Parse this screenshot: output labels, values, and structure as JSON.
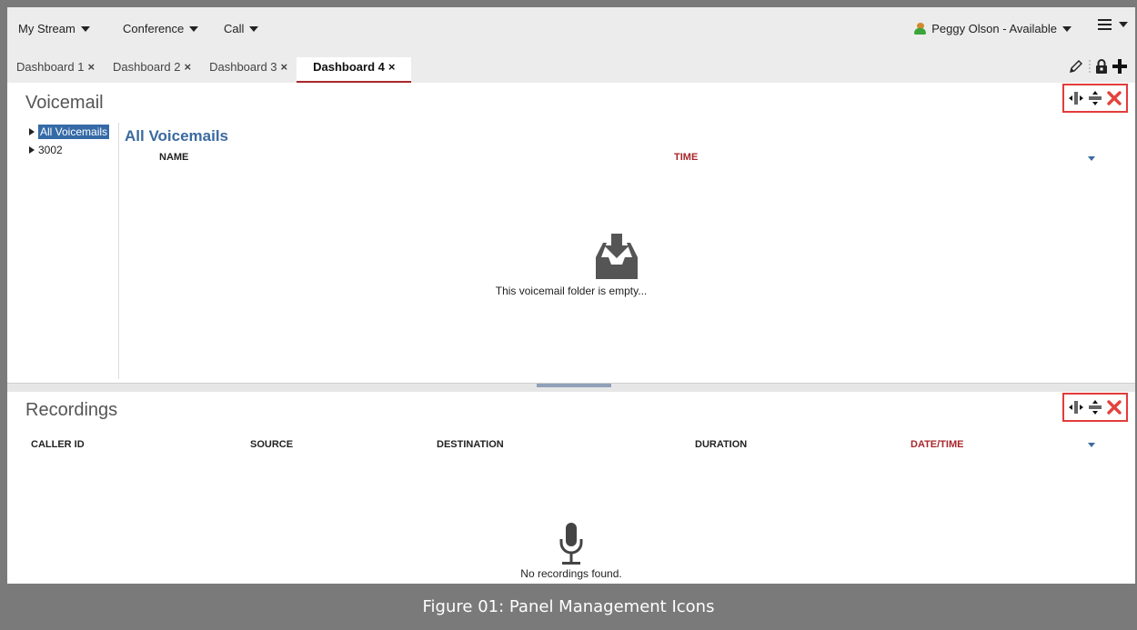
{
  "menubar": {
    "my_stream": "My Stream",
    "conference": "Conference",
    "call": "Call",
    "user_status": "Peggy Olson - Available"
  },
  "tabs": [
    {
      "label": "Dashboard 1",
      "close": "×"
    },
    {
      "label": "Dashboard 2",
      "close": "×"
    },
    {
      "label": "Dashboard 3",
      "close": "×"
    },
    {
      "label": "Dashboard 4",
      "close": "×"
    }
  ],
  "voicemail": {
    "title": "Voicemail",
    "tree": [
      "All Voicemails",
      "3002"
    ],
    "subtitle": "All Voicemails",
    "columns": [
      "NAME",
      "TIME"
    ],
    "empty_text": "This voicemail folder is empty..."
  },
  "recordings": {
    "title": "Recordings",
    "columns": [
      "CALLER ID",
      "SOURCE",
      "DESTINATION",
      "DURATION",
      "DATE/TIME"
    ],
    "empty_text": "No recordings found."
  },
  "caption": "Figure 01: Panel Management Icons",
  "colors": {
    "accent_red": "#a8262b",
    "highlight_blue": "#356aa7",
    "title_blue": "#3b6aa0",
    "box_red": "#e33b3b"
  }
}
